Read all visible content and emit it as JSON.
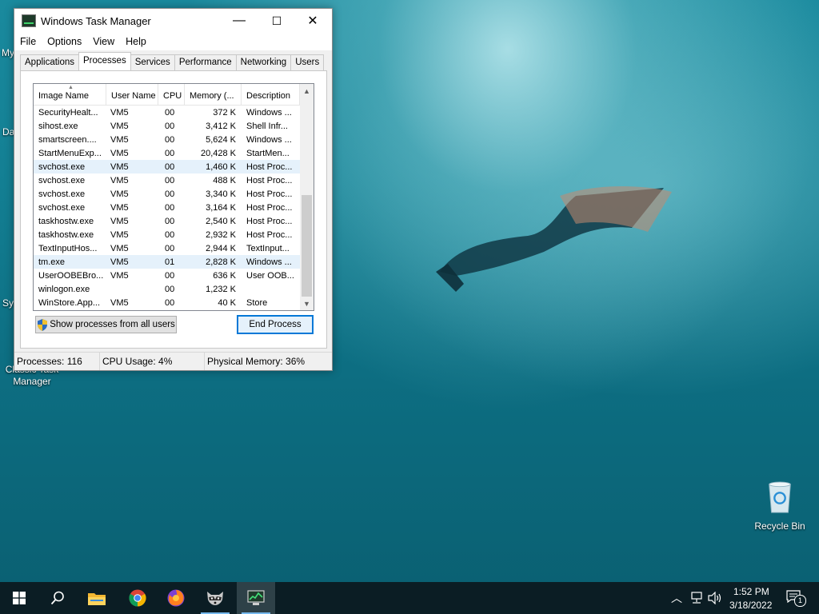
{
  "desktop": {
    "clipped_labels": [
      "My",
      "Da",
      "Sys"
    ],
    "classic_task_manager_label": "Classic Task Manager",
    "recycle_bin_label": "Recycle Bin"
  },
  "window": {
    "title": "Windows Task Manager",
    "controls": {
      "minimize": "—",
      "maximize": "☐",
      "close": "✕"
    },
    "menu": [
      "File",
      "Options",
      "View",
      "Help"
    ],
    "tabs": [
      "Applications",
      "Processes",
      "Services",
      "Performance",
      "Networking",
      "Users"
    ],
    "active_tab": "Processes",
    "columns": [
      "Image Name",
      "User Name",
      "CPU",
      "Memory (...",
      "Description"
    ],
    "rows": [
      {
        "name": "SecurityHealt...",
        "user": "VM5",
        "cpu": "00",
        "mem": "372 K",
        "desc": "Windows ...",
        "selected": false
      },
      {
        "name": "sihost.exe",
        "user": "VM5",
        "cpu": "00",
        "mem": "3,412 K",
        "desc": "Shell Infr...",
        "selected": false
      },
      {
        "name": "smartscreen....",
        "user": "VM5",
        "cpu": "00",
        "mem": "5,624 K",
        "desc": "Windows ...",
        "selected": false
      },
      {
        "name": "StartMenuExp...",
        "user": "VM5",
        "cpu": "00",
        "mem": "20,428 K",
        "desc": "StartMen...",
        "selected": false
      },
      {
        "name": "svchost.exe",
        "user": "VM5",
        "cpu": "00",
        "mem": "1,460 K",
        "desc": "Host Proc...",
        "selected": true
      },
      {
        "name": "svchost.exe",
        "user": "VM5",
        "cpu": "00",
        "mem": "488 K",
        "desc": "Host Proc...",
        "selected": false
      },
      {
        "name": "svchost.exe",
        "user": "VM5",
        "cpu": "00",
        "mem": "3,340 K",
        "desc": "Host Proc...",
        "selected": false
      },
      {
        "name": "svchost.exe",
        "user": "VM5",
        "cpu": "00",
        "mem": "3,164 K",
        "desc": "Host Proc...",
        "selected": false
      },
      {
        "name": "taskhostw.exe",
        "user": "VM5",
        "cpu": "00",
        "mem": "2,540 K",
        "desc": "Host Proc...",
        "selected": false
      },
      {
        "name": "taskhostw.exe",
        "user": "VM5",
        "cpu": "00",
        "mem": "2,932 K",
        "desc": "Host Proc...",
        "selected": false
      },
      {
        "name": "TextInputHos...",
        "user": "VM5",
        "cpu": "00",
        "mem": "2,944 K",
        "desc": "TextInput...",
        "selected": false
      },
      {
        "name": "tm.exe",
        "user": "VM5",
        "cpu": "01",
        "mem": "2,828 K",
        "desc": "Windows ...",
        "selected": true
      },
      {
        "name": "UserOOBEBro...",
        "user": "VM5",
        "cpu": "00",
        "mem": "636 K",
        "desc": "User OOB...",
        "selected": false
      },
      {
        "name": "winlogon.exe",
        "user": "",
        "cpu": "00",
        "mem": "1,232 K",
        "desc": "",
        "selected": false
      },
      {
        "name": "WinStore.App...",
        "user": "VM5",
        "cpu": "00",
        "mem": "40 K",
        "desc": "Store",
        "selected": false
      }
    ],
    "show_all_label": "Show processes from all users",
    "end_process_label": "End Process",
    "status": {
      "processes": "Processes: 116",
      "cpu": "CPU Usage: 4%",
      "memory": "Physical Memory: 36%"
    }
  },
  "taskbar": {
    "items": [
      "start-icon",
      "search-icon",
      "file-explorer-icon",
      "chrome-icon",
      "firefox-icon",
      "raccoon-app-icon",
      "task-manager-icon"
    ],
    "time": "1:52 PM",
    "date": "3/18/2022",
    "notification_count": "1"
  },
  "colors": {
    "accent": "#0078d7",
    "selection": "#e5f1fb",
    "taskbar": "#0b1d24",
    "desktop_water": "#137f93"
  }
}
